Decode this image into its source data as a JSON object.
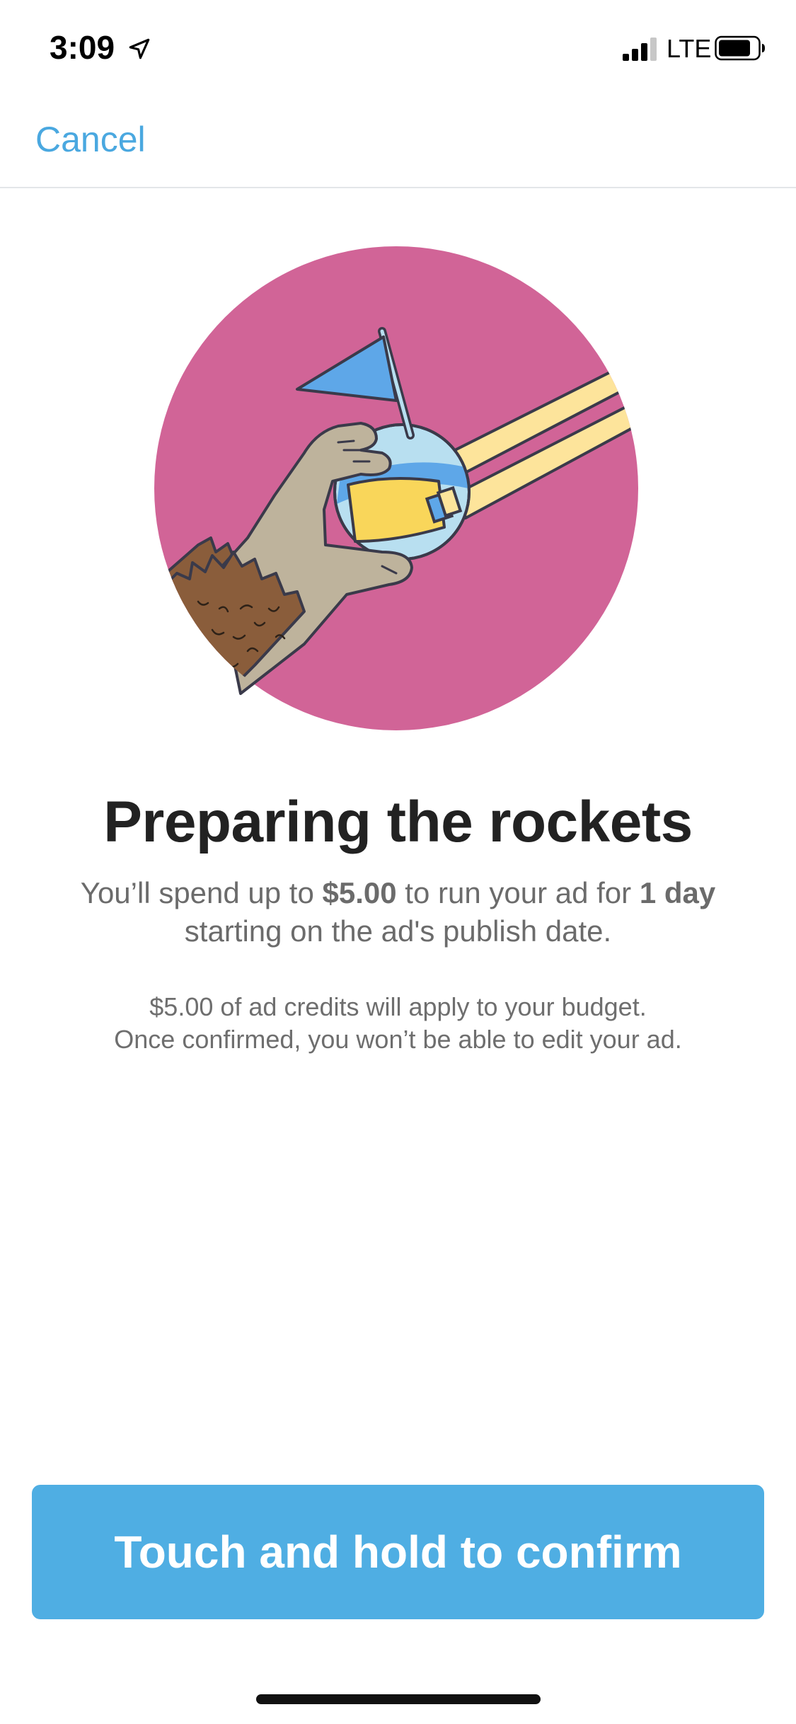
{
  "status_bar": {
    "time": "3:09",
    "network": "LTE",
    "icons": [
      "location-arrow-icon",
      "cellular-signal-icon",
      "battery-icon"
    ]
  },
  "nav": {
    "cancel_label": "Cancel"
  },
  "illustration": {
    "name": "hand-holding-planet-illustration",
    "colors": {
      "circle": "#d16497",
      "planet": "#b8dff0",
      "planet_band": "#5ea7e8",
      "flag": "#5ea7e8",
      "strap": "#fde49b",
      "buckle": "#f9d65a",
      "hand": "#beb39c",
      "sleeve": "#8a5d3b"
    }
  },
  "content": {
    "headline": "Preparing the rockets",
    "summary_part1": "You’ll spend up to ",
    "summary_amount": "$5.00",
    "summary_part2": " to run your ad for ",
    "summary_duration": "1 day",
    "summary_part3": " starting on the ad's publish date.",
    "note_line1": "$5.00 of ad credits will apply to your budget.",
    "note_line2": "Once confirmed, you won’t be able to edit your ad."
  },
  "actions": {
    "confirm_label": "Touch and hold to confirm"
  },
  "colors": {
    "accent": "#4faee3",
    "link": "#4aa8e0",
    "headline_text": "#222222",
    "body_text": "#6b6b6b"
  }
}
